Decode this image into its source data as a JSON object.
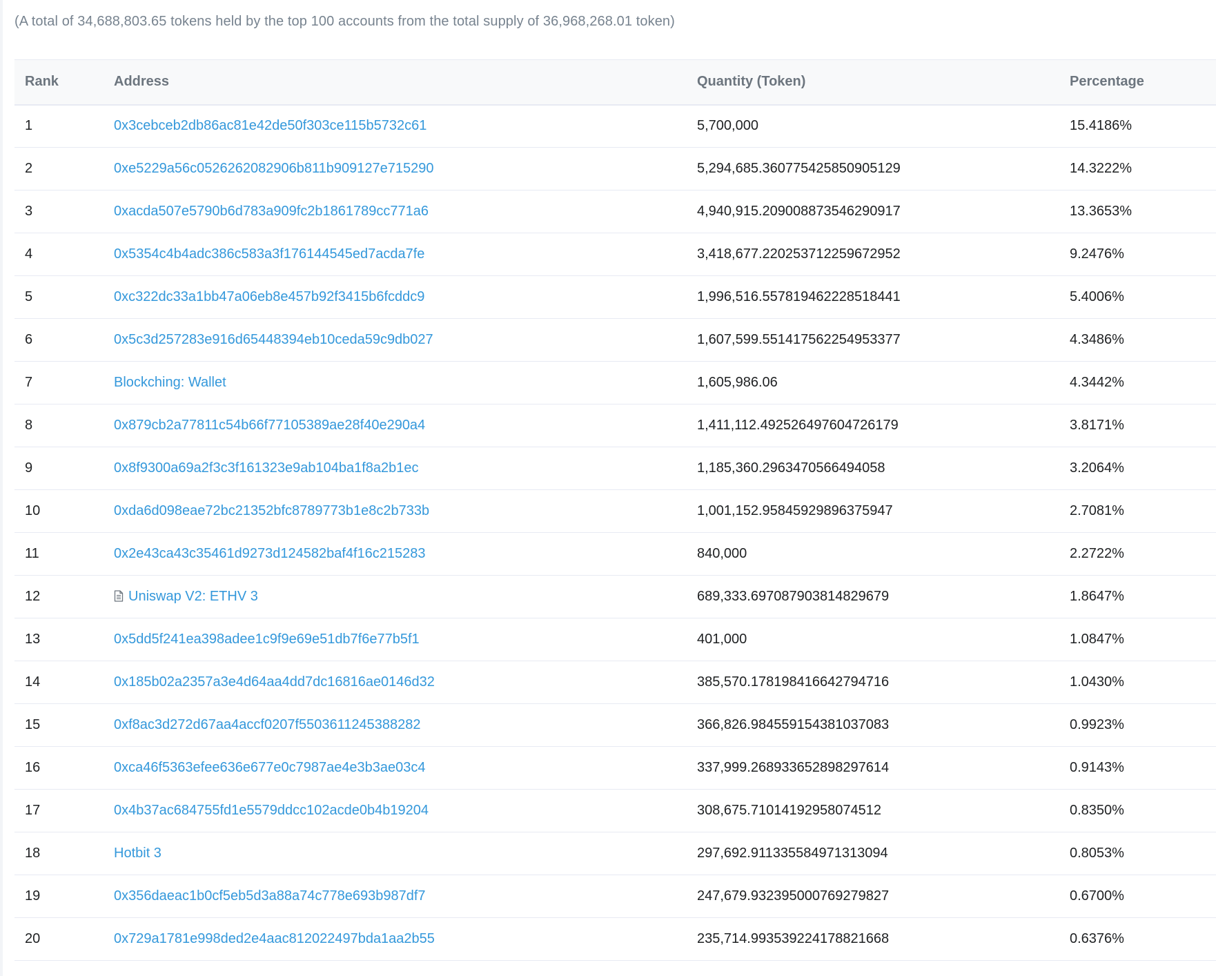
{
  "summary": "(A total of 34,688,803.65 tokens held by the top 100 accounts from the total supply of 36,968,268.01 token)",
  "table": {
    "headers": {
      "rank": "Rank",
      "address": "Address",
      "quantity": "Quantity (Token)",
      "percentage": "Percentage"
    },
    "rows": [
      {
        "rank": "1",
        "address": "0x3cebceb2db86ac81e42de50f303ce115b5732c61",
        "quantity": "5,700,000",
        "percentage": "15.4186%",
        "icon": ""
      },
      {
        "rank": "2",
        "address": "0xe5229a56c0526262082906b811b909127e715290",
        "quantity": "5,294,685.360775425850905129",
        "percentage": "14.3222%",
        "icon": ""
      },
      {
        "rank": "3",
        "address": "0xacda507e5790b6d783a909fc2b1861789cc771a6",
        "quantity": "4,940,915.209008873546290917",
        "percentage": "13.3653%",
        "icon": ""
      },
      {
        "rank": "4",
        "address": "0x5354c4b4adc386c583a3f176144545ed7acda7fe",
        "quantity": "3,418,677.220253712259672952",
        "percentage": "9.2476%",
        "icon": ""
      },
      {
        "rank": "5",
        "address": "0xc322dc33a1bb47a06eb8e457b92f3415b6fcddc9",
        "quantity": "1,996,516.557819462228518441",
        "percentage": "5.4006%",
        "icon": ""
      },
      {
        "rank": "6",
        "address": "0x5c3d257283e916d65448394eb10ceda59c9db027",
        "quantity": "1,607,599.551417562254953377",
        "percentage": "4.3486%",
        "icon": ""
      },
      {
        "rank": "7",
        "address": "Blockching: Wallet",
        "quantity": "1,605,986.06",
        "percentage": "4.3442%",
        "icon": ""
      },
      {
        "rank": "8",
        "address": "0x879cb2a77811c54b66f77105389ae28f40e290a4",
        "quantity": "1,411,112.492526497604726179",
        "percentage": "3.8171%",
        "icon": ""
      },
      {
        "rank": "9",
        "address": "0x8f9300a69a2f3c3f161323e9ab104ba1f8a2b1ec",
        "quantity": "1,185,360.2963470566494058",
        "percentage": "3.2064%",
        "icon": ""
      },
      {
        "rank": "10",
        "address": "0xda6d098eae72bc21352bfc8789773b1e8c2b733b",
        "quantity": "1,001,152.95845929896375947",
        "percentage": "2.7081%",
        "icon": ""
      },
      {
        "rank": "11",
        "address": "0x2e43ca43c35461d9273d124582baf4f16c215283",
        "quantity": "840,000",
        "percentage": "2.2722%",
        "icon": ""
      },
      {
        "rank": "12",
        "address": "Uniswap V2: ETHV 3",
        "quantity": "689,333.697087903814829679",
        "percentage": "1.8647%",
        "icon": "contract-document-icon"
      },
      {
        "rank": "13",
        "address": "0x5dd5f241ea398adee1c9f9e69e51db7f6e77b5f1",
        "quantity": "401,000",
        "percentage": "1.0847%",
        "icon": ""
      },
      {
        "rank": "14",
        "address": "0x185b02a2357a3e4d64aa4dd7dc16816ae0146d32",
        "quantity": "385,570.178198416642794716",
        "percentage": "1.0430%",
        "icon": ""
      },
      {
        "rank": "15",
        "address": "0xf8ac3d272d67aa4accf0207f5503611245388282",
        "quantity": "366,826.984559154381037083",
        "percentage": "0.9923%",
        "icon": ""
      },
      {
        "rank": "16",
        "address": "0xca46f5363efee636e677e0c7987ae4e3b3ae03c4",
        "quantity": "337,999.268933652898297614",
        "percentage": "0.9143%",
        "icon": ""
      },
      {
        "rank": "17",
        "address": "0x4b37ac684755fd1e5579ddcc102acde0b4b19204",
        "quantity": "308,675.71014192958074512",
        "percentage": "0.8350%",
        "icon": ""
      },
      {
        "rank": "18",
        "address": "Hotbit 3",
        "quantity": "297,692.911335584971313094",
        "percentage": "0.8053%",
        "icon": ""
      },
      {
        "rank": "19",
        "address": "0x356daeac1b0cf5eb5d3a88a74c778e693b987df7",
        "quantity": "247,679.932395000769279827",
        "percentage": "0.6700%",
        "icon": ""
      },
      {
        "rank": "20",
        "address": "0x729a1781e998ded2e4aac812022497bda1aa2b55",
        "quantity": "235,714.993539224178821668",
        "percentage": "0.6376%",
        "icon": ""
      }
    ]
  },
  "colors": {
    "link": "#3498db",
    "text": "#1e2022",
    "muted": "#77838f",
    "header_bg": "#f8f9fa",
    "border": "#e7eaf3"
  }
}
